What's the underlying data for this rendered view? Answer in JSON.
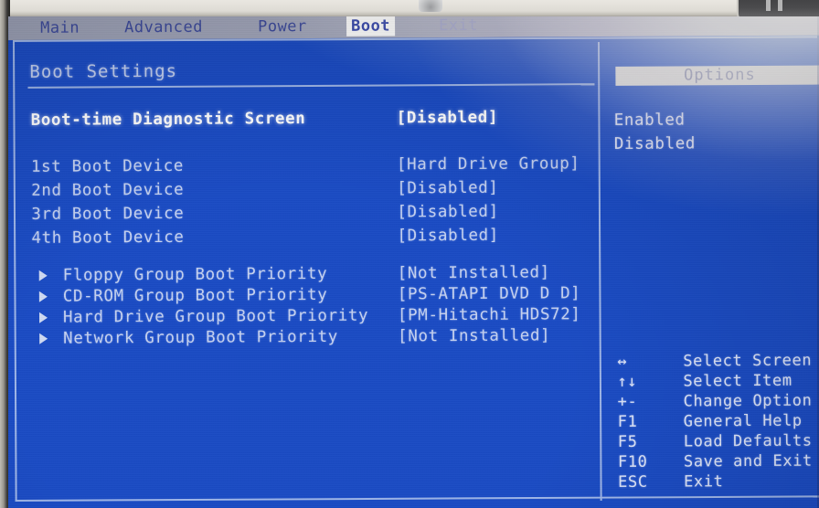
{
  "menu": {
    "items": [
      {
        "label": "Main",
        "active": false,
        "dim": false
      },
      {
        "label": "Advanced",
        "active": false,
        "dim": false
      },
      {
        "label": "Power",
        "active": false,
        "dim": false
      },
      {
        "label": "Boot",
        "active": true,
        "dim": false
      },
      {
        "label": "Exit",
        "active": false,
        "dim": true
      }
    ]
  },
  "main": {
    "section_title": "Boot Settings",
    "settings": [
      {
        "label": "Boot-time Diagnostic Screen",
        "value": "[Disabled]",
        "selected": true,
        "submenu": false
      },
      {
        "label": "1st Boot Device",
        "value": "[Hard Drive Group]",
        "selected": false,
        "submenu": false
      },
      {
        "label": "2nd Boot Device",
        "value": "[Disabled]",
        "selected": false,
        "submenu": false
      },
      {
        "label": "3rd Boot Device",
        "value": "[Disabled]",
        "selected": false,
        "submenu": false
      },
      {
        "label": "4th Boot Device",
        "value": "[Disabled]",
        "selected": false,
        "submenu": false
      },
      {
        "label": "Floppy Group Boot Priority",
        "value": "[Not Installed]",
        "selected": false,
        "submenu": true
      },
      {
        "label": "CD-ROM Group Boot Priority",
        "value": "[PS-ATAPI DVD D D]",
        "selected": false,
        "submenu": true
      },
      {
        "label": "Hard Drive Group Boot Priority",
        "value": "[PM-Hitachi HDS72]",
        "selected": false,
        "submenu": true
      },
      {
        "label": "Network Group Boot Priority",
        "value": "[Not Installed]",
        "selected": false,
        "submenu": true
      }
    ]
  },
  "options_panel": {
    "title": "Options",
    "choices": [
      "Enabled",
      "Disabled"
    ]
  },
  "key_legend": [
    {
      "key": "↔",
      "desc": "Select Screen"
    },
    {
      "key": "↑↓",
      "desc": "Select Item"
    },
    {
      "key": "+-",
      "desc": "Change Option"
    },
    {
      "key": "F1",
      "desc": "General Help"
    },
    {
      "key": "F5",
      "desc": "Load Defaults"
    },
    {
      "key": "F10",
      "desc": "Save and Exit"
    },
    {
      "key": "ESC",
      "desc": "Exit"
    }
  ],
  "colors": {
    "screen_blue": "#1a4bc4",
    "menubar": "#a3a7bb",
    "menu_text": "#3c4a9c",
    "frame_line": "#9fb6e8",
    "body_text": "#c6d2f0",
    "selected_text": "#ffffff",
    "options_head_bg": "#e6e6e0"
  }
}
